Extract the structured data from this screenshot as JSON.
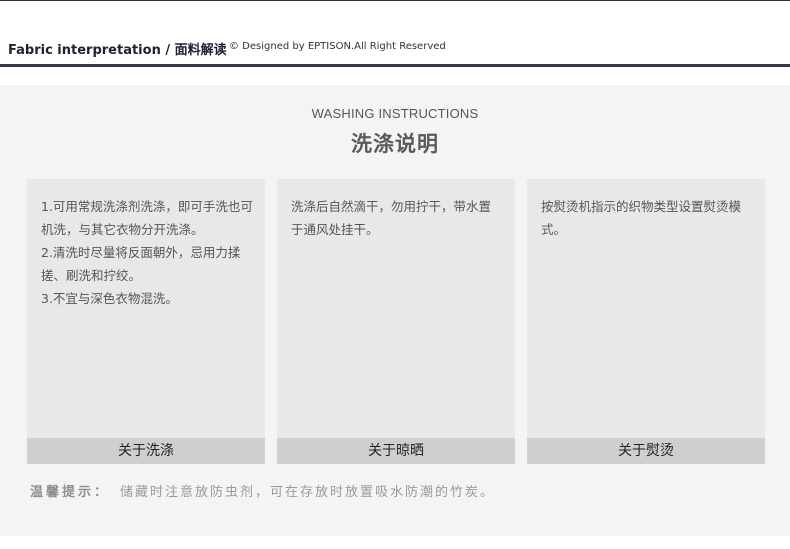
{
  "header": {
    "title": "Fabric interpretation /  面料解读",
    "credit": "© Designed by EPTISON.All Right Reserved"
  },
  "section": {
    "title_en": "WASHING INSTRUCTIONS",
    "title_cn": "洗涤说明"
  },
  "cards": [
    {
      "lines": [
        "1.可用常规洗涤剂洗涤，即可手洗也可机洗，与其它衣物分开洗涤。",
        "2.清洗时尽量将反面朝外，忌用力揉搓、刷洗和拧绞。",
        "3.不宜与深色衣物混洗。"
      ],
      "footer": "关于洗涤"
    },
    {
      "lines": [
        "洗涤后自然滴干，勿用拧干，带水置于通风处挂干。"
      ],
      "footer": "关于晾晒"
    },
    {
      "lines": [
        "按熨烫机指示的织物类型设置熨烫模式。"
      ],
      "footer": "关于熨烫"
    }
  ],
  "tip": {
    "label": "温馨提示：",
    "text": "储藏时注意放防虫剂，可在存放时放置吸水防潮的竹炭。"
  }
}
